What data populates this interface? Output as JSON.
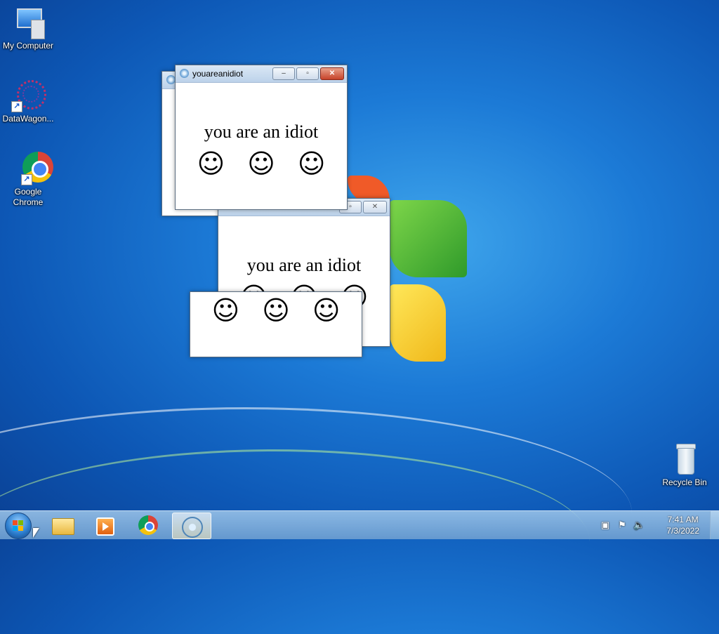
{
  "desktop": {
    "icons": [
      {
        "label": "My Computer",
        "icon": "computer-icon"
      },
      {
        "label": "DataWagon...",
        "icon": "datawagon-icon"
      },
      {
        "label": "Google Chrome",
        "icon": "chrome-icon"
      },
      {
        "label": "Recycle Bin",
        "icon": "recycle-bin-icon"
      }
    ]
  },
  "windows": [
    {
      "title": "youareanidiot",
      "message": "you are an idiot",
      "smiley": "☺"
    },
    {
      "title": "",
      "message": "you are an idiot",
      "smiley": "☺"
    },
    {
      "title": "",
      "message": "",
      "smiley": "☺"
    }
  ],
  "window_buttons": {
    "minimize": "–",
    "maximize": "▫",
    "close": "✕"
  },
  "taskbar": {
    "clock_time": "7:41 AM",
    "clock_date": "7/3/2022"
  },
  "colors": {
    "accent": "#1c7ad6",
    "close_active": "#c7432a"
  }
}
